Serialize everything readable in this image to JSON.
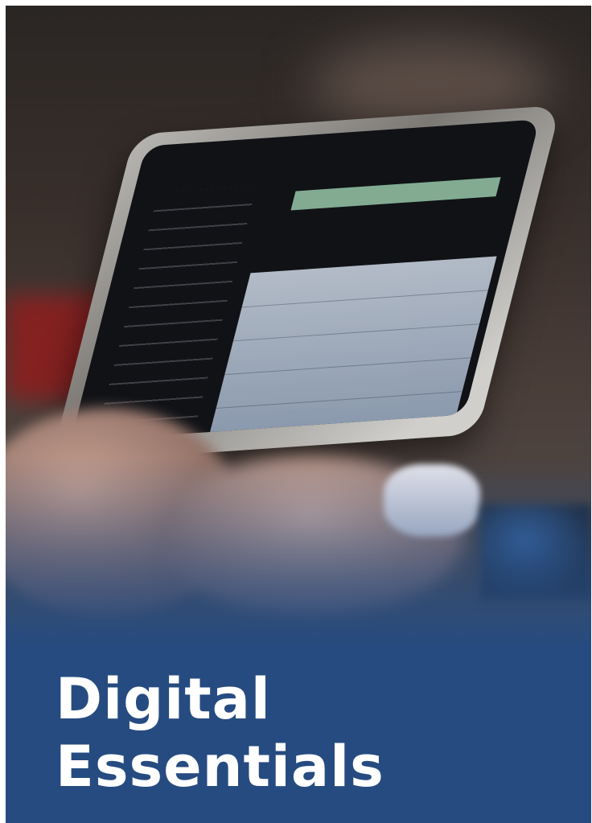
{
  "title": {
    "line1": "Digital",
    "line2": "Essentials"
  },
  "colors": {
    "banner": "#264b80",
    "title_text": "#ffffff"
  },
  "photo": {
    "subject": "hands-holding-tablet"
  }
}
